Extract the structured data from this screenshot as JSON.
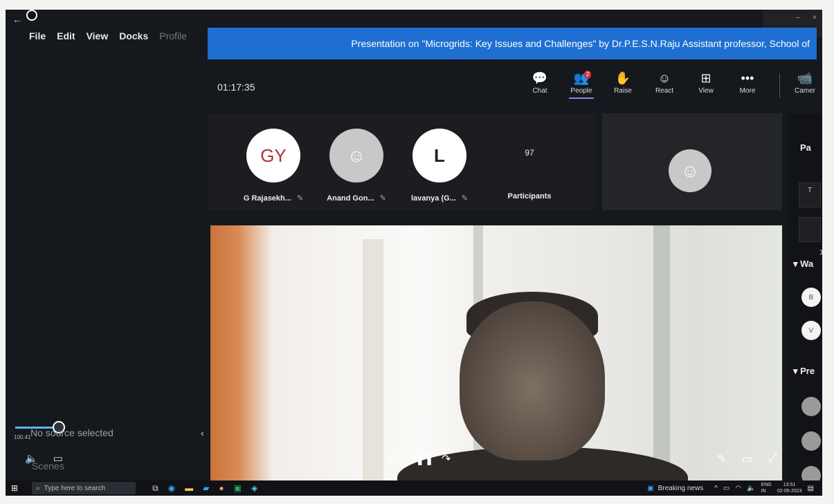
{
  "obs": {
    "back_arrow": "←",
    "menu": [
      "File",
      "Edit",
      "View",
      "Docks",
      "Profile"
    ],
    "no_source": "No source selected",
    "slider_value": "100.41",
    "scenes_label": "Scenes",
    "collapse_arrow": "‹"
  },
  "meeting": {
    "title": "Presentation on \"Microgrids: Key Issues and Challenges\" by Dr.P.E.S.N.Raju Assistant professor, School of",
    "timer": "01:17:35",
    "toolbar": [
      {
        "label": "Chat",
        "icon": "chat-icon",
        "glyph": "💬"
      },
      {
        "label": "People",
        "icon": "people-icon",
        "glyph": "👥",
        "badge": "2"
      },
      {
        "label": "Raise",
        "icon": "raise-hand-icon",
        "glyph": "✋"
      },
      {
        "label": "React",
        "icon": "react-icon",
        "glyph": "☺"
      },
      {
        "label": "View",
        "icon": "view-icon",
        "glyph": "⊞"
      },
      {
        "label": "More",
        "icon": "more-icon",
        "glyph": "•••"
      }
    ],
    "camera_label": "Camer",
    "participants": [
      {
        "initials": "GY",
        "name": "G Rajasekh..."
      },
      {
        "initials": "",
        "name": "Anand Gon..."
      },
      {
        "initials": "L",
        "name": "lavanya (G..."
      }
    ],
    "participant_count": "97",
    "participant_count_label": "Participants",
    "side_panel": {
      "heading": "Pa",
      "box_label": "T",
      "waiting_label": "Wa",
      "presenters_label": "Pre",
      "avatar_1": "B",
      "avatar_2": "V"
    }
  },
  "taskbar": {
    "search_placeholder": "Type here to search",
    "news": "Breaking news",
    "lang_1": "ENG",
    "lang_2": "IN",
    "time": "13:51",
    "date": "02-05-2023"
  }
}
